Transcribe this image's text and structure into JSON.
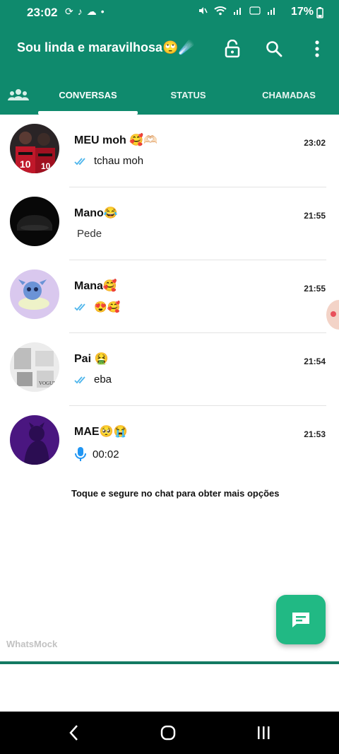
{
  "status_bar": {
    "time": "23:02",
    "battery": "17%",
    "left_icons": [
      "sync-icon",
      "tiktok-icon",
      "cloud-icon",
      "dot-icon"
    ],
    "right_icons": [
      "mute-icon",
      "wifi-icon",
      "signal-icon",
      "volte-icon",
      "signal-icon",
      "battery-icon"
    ]
  },
  "header": {
    "title": "Sou linda e maravilhosa🙄☄️",
    "icons": [
      "lock-icon",
      "search-icon",
      "more-vert-icon"
    ]
  },
  "tabs": {
    "community_icon": "community-icon",
    "items": [
      "CONVERSAS",
      "STATUS",
      "CHAMADAS"
    ],
    "active": "CONVERSAS"
  },
  "chats": [
    {
      "name": "MEU moh 🥰🫶🏻",
      "message": "tchau moh",
      "time": "23:02",
      "status": "read"
    },
    {
      "name": "Mano😂",
      "message": "Pede",
      "time": "21:55",
      "status": "none"
    },
    {
      "name": "Mana🥰",
      "message": "😍🥰",
      "time": "21:55",
      "status": "read"
    },
    {
      "name": "Pai 🤮",
      "message": "eba",
      "time": "21:54",
      "status": "read"
    },
    {
      "name": "MAE🥺😭",
      "message": "00:02",
      "time": "21:53",
      "status": "voice"
    }
  ],
  "hint": "Toque e segure no chat para obter mais opções",
  "watermark": "WhatsMock",
  "colors": {
    "header": "#0f8a6d",
    "fab": "#21b984",
    "read_ticks": "#4fb6ec",
    "mic": "#2196f3"
  },
  "navbar": [
    "back-icon",
    "home-icon",
    "recents-icon"
  ]
}
